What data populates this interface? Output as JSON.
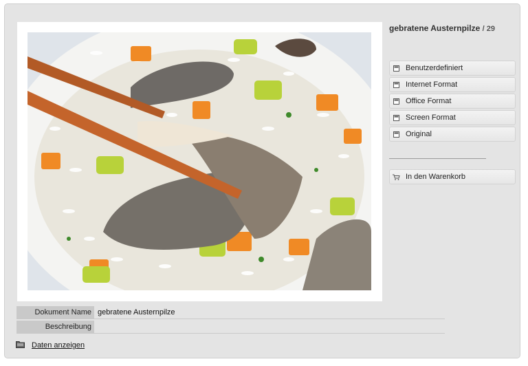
{
  "product": {
    "title": "gebratene Austernpilze",
    "count": "/ 29"
  },
  "menu": {
    "items": [
      {
        "label": "Benutzerdefiniert",
        "icon": "format-icon"
      },
      {
        "label": "Internet Format",
        "icon": "format-icon"
      },
      {
        "label": "Office Format",
        "icon": "format-icon"
      },
      {
        "label": "Screen Format",
        "icon": "format-icon"
      },
      {
        "label": "Original",
        "icon": "format-icon"
      }
    ]
  },
  "cart": {
    "label": "In den Warenkorb",
    "icon": "cart-icon"
  },
  "meta": {
    "rows": [
      {
        "label": "Dokument Name",
        "value": "gebratene Austernpilze"
      },
      {
        "label": "Beschreibung",
        "value": ""
      }
    ]
  },
  "show_data": {
    "label": "Daten anzeigen",
    "icon": "folder-icon"
  }
}
